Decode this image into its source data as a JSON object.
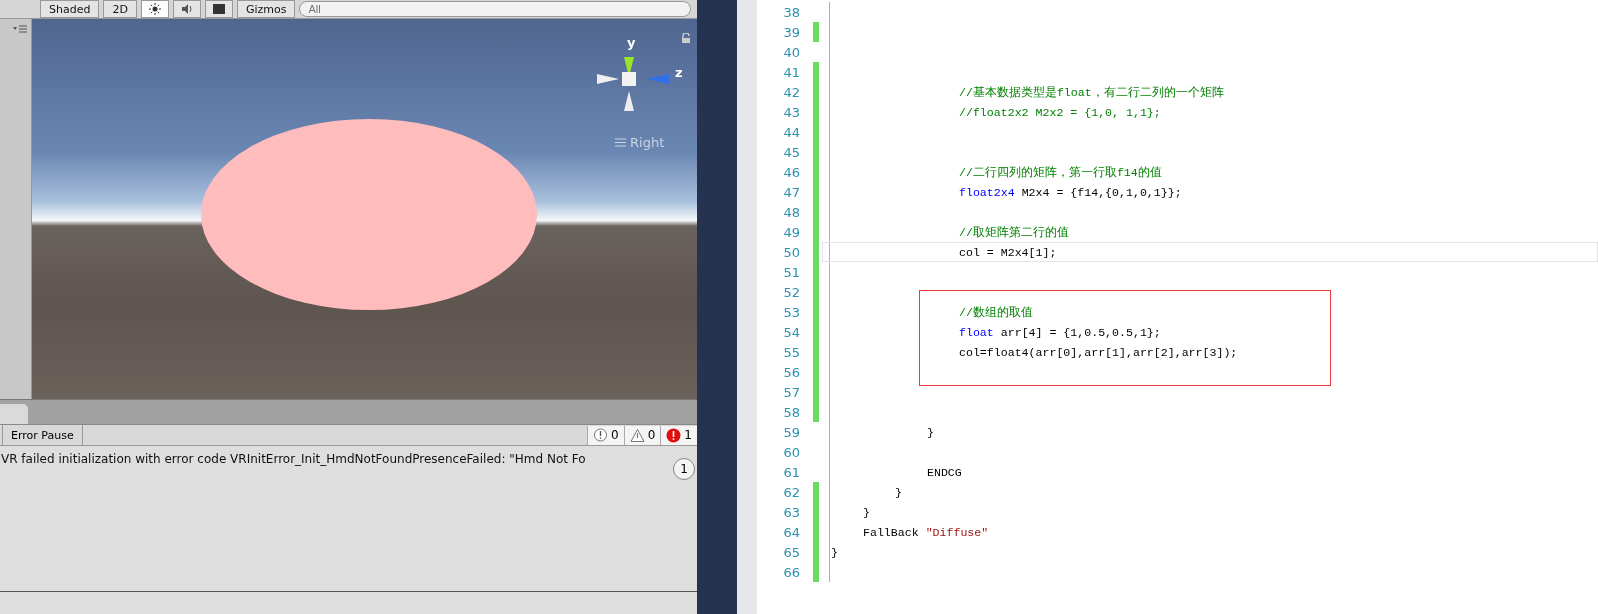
{
  "scene_toolbar": {
    "shading": "Shaded",
    "mode_2d": "2D",
    "gizmos": "Gizmos",
    "search": {
      "placeholder": "All"
    }
  },
  "scene_view": {
    "gizmo": {
      "y_label": "y",
      "z_label": "z",
      "view_label": "Right"
    }
  },
  "console": {
    "error_pause": "Error Pause",
    "counts": [
      {
        "kind": "info",
        "count": "0"
      },
      {
        "kind": "warning",
        "count": "0"
      },
      {
        "kind": "error",
        "count": "1"
      }
    ],
    "messages": [
      {
        "text": "VR failed initialization with error code VRInitError_Init_HmdNotFoundPresenceFailed: \"Hmd Not Fo",
        "count": "1"
      }
    ]
  },
  "editor": {
    "lines": [
      {
        "number": "38",
        "changed": false,
        "current": false,
        "boxed": false
      },
      {
        "number": "39",
        "changed": true,
        "current": false,
        "boxed": false
      },
      {
        "number": "40",
        "changed": false,
        "current": false,
        "boxed": false
      },
      {
        "number": "41",
        "changed": true,
        "current": false,
        "boxed": false
      },
      {
        "number": "42",
        "changed": true,
        "current": false,
        "boxed": false,
        "tokens": [
          {
            "kind": "comment",
            "text": "\t\t\t\t//基本数据类型是float，有二行二列的一个矩阵"
          }
        ]
      },
      {
        "number": "43",
        "changed": true,
        "current": false,
        "boxed": false,
        "tokens": [
          {
            "kind": "comment",
            "text": "\t\t\t\t//float2x2 M2x2 = {1,0, 1,1};"
          }
        ]
      },
      {
        "number": "44",
        "changed": true,
        "current": false,
        "boxed": false
      },
      {
        "number": "45",
        "changed": true,
        "current": false,
        "boxed": false
      },
      {
        "number": "46",
        "changed": true,
        "current": false,
        "boxed": false,
        "tokens": [
          {
            "kind": "comment",
            "text": "\t\t\t\t//二行四列的矩阵，第一行取f14的值"
          }
        ]
      },
      {
        "number": "47",
        "changed": true,
        "current": false,
        "boxed": false,
        "tokens": [
          {
            "kind": "keyword",
            "text": "\t\t\t\tfloat2x4"
          },
          {
            "kind": "plain",
            "text": " M2x4 = {f14,{0,1,0,1}};"
          }
        ]
      },
      {
        "number": "48",
        "changed": true,
        "current": false,
        "boxed": false
      },
      {
        "number": "49",
        "changed": true,
        "current": false,
        "boxed": false,
        "tokens": [
          {
            "kind": "comment",
            "text": "\t\t\t\t//取矩阵第二行的值"
          }
        ]
      },
      {
        "number": "50",
        "changed": true,
        "current": true,
        "boxed": false,
        "tokens": [
          {
            "kind": "plain",
            "text": "\t\t\t\tcol = M2x4[1];"
          }
        ]
      },
      {
        "number": "51",
        "changed": true,
        "current": false,
        "boxed": false
      },
      {
        "number": "52",
        "changed": true,
        "current": false,
        "boxed": false
      },
      {
        "number": "53",
        "changed": true,
        "current": false,
        "boxed": true,
        "tokens": [
          {
            "kind": "comment",
            "text": "\t\t\t\t//数组的取值"
          }
        ]
      },
      {
        "number": "54",
        "changed": true,
        "current": false,
        "boxed": true,
        "tokens": [
          {
            "kind": "keyword",
            "text": "\t\t\t\tfloat"
          },
          {
            "kind": "plain",
            "text": " arr[4] = {1,0.5,0.5,1};"
          }
        ]
      },
      {
        "number": "55",
        "changed": true,
        "current": false,
        "boxed": true,
        "tokens": [
          {
            "kind": "plain",
            "text": "\t\t\t\tcol=float4(arr[0],arr[1],arr[2],arr[3]);"
          }
        ]
      },
      {
        "number": "56",
        "changed": true,
        "current": false,
        "boxed": true
      },
      {
        "number": "57",
        "changed": true,
        "current": false,
        "boxed": false
      },
      {
        "number": "58",
        "changed": true,
        "current": false,
        "boxed": false
      },
      {
        "number": "59",
        "changed": false,
        "current": false,
        "boxed": false,
        "tokens": [
          {
            "kind": "plain",
            "text": "\t\t\t}"
          }
        ]
      },
      {
        "number": "60",
        "changed": false,
        "current": false,
        "boxed": false
      },
      {
        "number": "61",
        "changed": false,
        "current": false,
        "boxed": false,
        "tokens": [
          {
            "kind": "plain",
            "text": "\t\t\tENDCG"
          }
        ]
      },
      {
        "number": "62",
        "changed": true,
        "current": false,
        "boxed": false,
        "tokens": [
          {
            "kind": "plain",
            "text": "\t\t}"
          }
        ]
      },
      {
        "number": "63",
        "changed": true,
        "current": false,
        "boxed": false,
        "tokens": [
          {
            "kind": "plain",
            "text": "\t}"
          }
        ]
      },
      {
        "number": "64",
        "changed": true,
        "current": false,
        "boxed": false,
        "tokens": [
          {
            "kind": "plain",
            "text": "\tFallBack "
          },
          {
            "kind": "string",
            "text": "\"Diffuse\""
          }
        ]
      },
      {
        "number": "65",
        "changed": true,
        "current": false,
        "boxed": false,
        "tokens": [
          {
            "kind": "plain",
            "text": "}"
          }
        ]
      },
      {
        "number": "66",
        "changed": true,
        "current": false,
        "boxed": false
      }
    ]
  }
}
